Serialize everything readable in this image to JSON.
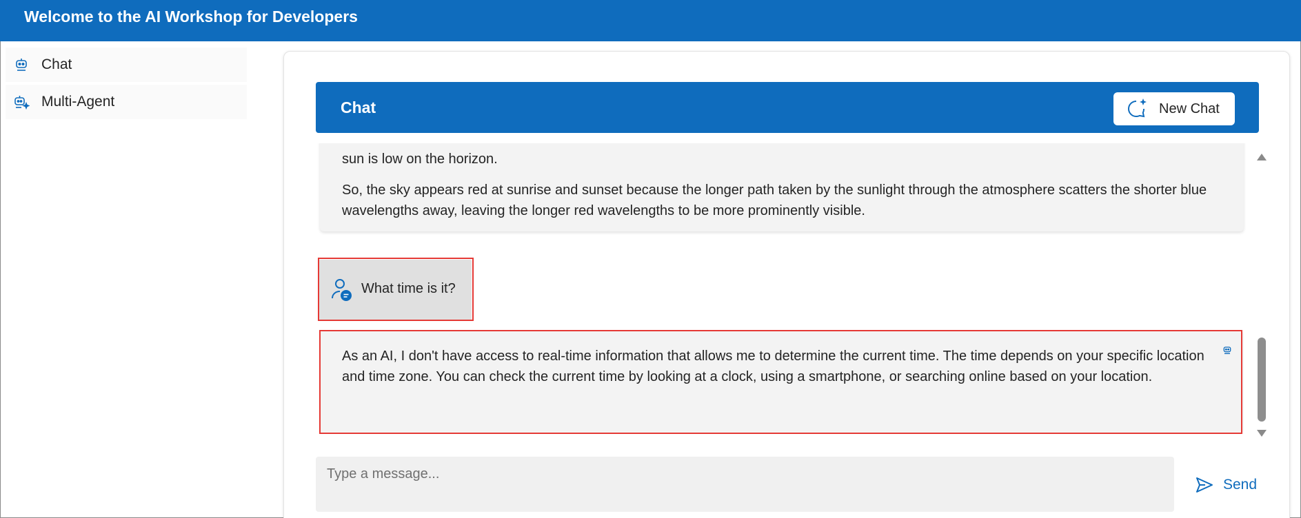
{
  "header": {
    "title": "Welcome to the AI Workshop for Developers"
  },
  "sidebar": {
    "items": [
      {
        "label": "Chat",
        "icon": "bot-icon"
      },
      {
        "label": "Multi-Agent",
        "icon": "bot-sparkle-icon"
      }
    ]
  },
  "chat": {
    "title": "Chat",
    "new_chat_label": "New Chat",
    "messages": [
      {
        "role": "assistant",
        "paragraphs": [
          "sun is low on the horizon.",
          "So, the sky appears red at sunrise and sunset because the longer path taken by the sunlight through the atmosphere scatters the shorter blue wavelengths away, leaving the longer red wavelengths to be more prominently visible."
        ]
      },
      {
        "role": "user",
        "text": "What time is it?"
      },
      {
        "role": "assistant",
        "text": "As an AI, I don't have access to real-time information that allows me to determine the current time. The time depends on your specific location and time zone. You can check the current time by looking at a clock, using a smartphone, or searching online based on your location."
      }
    ]
  },
  "composer": {
    "placeholder": "Type a message...",
    "value": "",
    "send_label": "Send"
  },
  "colors": {
    "brand": "#0f6cbd",
    "highlight": "#e53935",
    "bubble": "#f3f3f3",
    "user_bubble": "#e0e0e0"
  }
}
